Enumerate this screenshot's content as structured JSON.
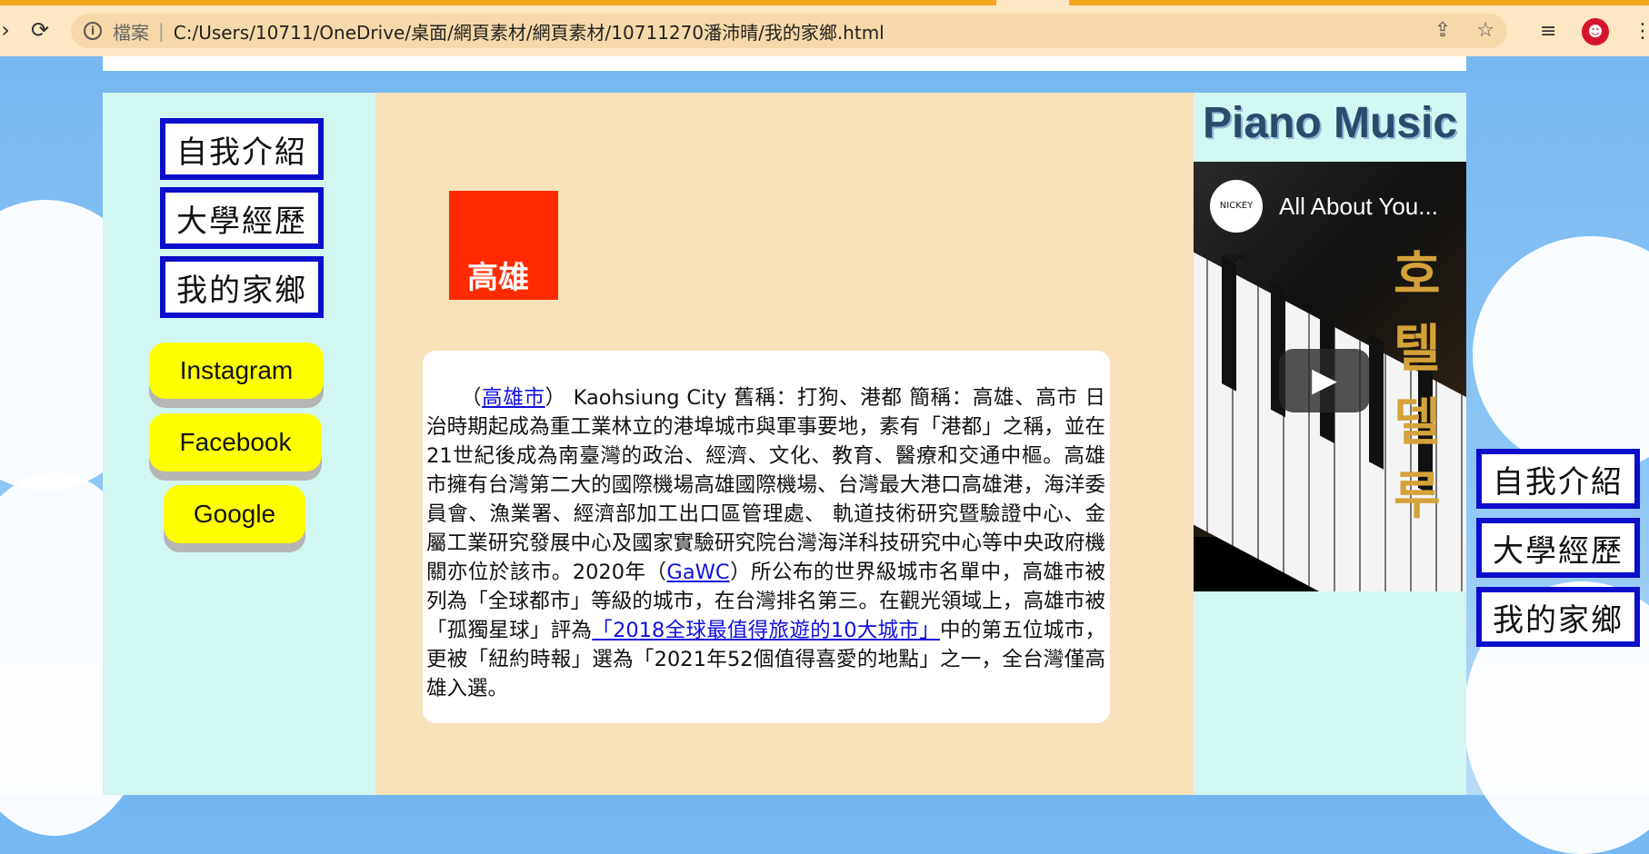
{
  "browser": {
    "back_icon": "back-arrow-icon",
    "reload_icon": "reload-icon",
    "scheme_label": "檔案",
    "separator": "|",
    "url": "C:/Users/10711/OneDrive/桌面/網頁素材/網頁素材/10711270潘沛晴/我的家鄉.html",
    "share_icon": "share-icon",
    "bookmark_icon": "star-icon",
    "reading_list_icon": "reading-list-icon",
    "profile_icon": "profile-avatar-icon",
    "menu_icon": "kebab-menu-icon"
  },
  "left_nav": {
    "items": [
      "自我介紹",
      "大學經歷",
      "我的家鄉"
    ],
    "links": [
      "Instagram",
      "Facebook",
      "Google"
    ]
  },
  "main": {
    "city_title": "高雄",
    "paragraph": {
      "open_paren": "（",
      "city_link": "高雄市",
      "part1": "） Kaohsiung City 舊稱：打狗、港都 簡稱：高雄、高市 日治時期起成為重工業林立的港埠城市與軍事要地，素有「港都」之稱，並在21世紀後成為南臺灣的政治、經濟、文化、教育、醫療和交通中樞。高雄市擁有台灣第二大的國際機場高雄國際機場、台灣最大港口高雄港，海洋委員會、漁業署、經濟部加工出口區管理處、 軌道技術研究暨驗證中心、金屬工業研究發展中心及國家實驗研究院台灣海洋科技研究中心等中央政府機關亦位於該市。2020年（",
      "gawc_link": "GaWC",
      "part2": "）所公布的世界級城市名單中，高雄市被列為「全球都市」等級的城市，在台灣排名第三。在觀光領域上，高雄市被「孤獨星球」評為",
      "ranking_link": "「2018全球最值得旅遊的10大城市」",
      "part3": "中的第五位城市，更被「紐約時報」選為「2021年52個值得喜愛的地點」之一，全台灣僅高雄入選。"
    }
  },
  "right_panel": {
    "title": "Piano Music",
    "video": {
      "channel_logo_text": "NICKEY PIANO",
      "title": "All About You...",
      "overlay_text": "호텔 델루",
      "play_icon": "play-icon"
    }
  },
  "floating_nav": {
    "items": [
      "自我介紹",
      "大學經歷",
      "我的家鄉"
    ]
  },
  "colors": {
    "nav_border": "#0d0dcc",
    "link_pill": "#ffff00",
    "city_tile": "#ff2a00",
    "left_right_bg": "#d2f7f2",
    "main_bg": "#f7e1b8"
  }
}
